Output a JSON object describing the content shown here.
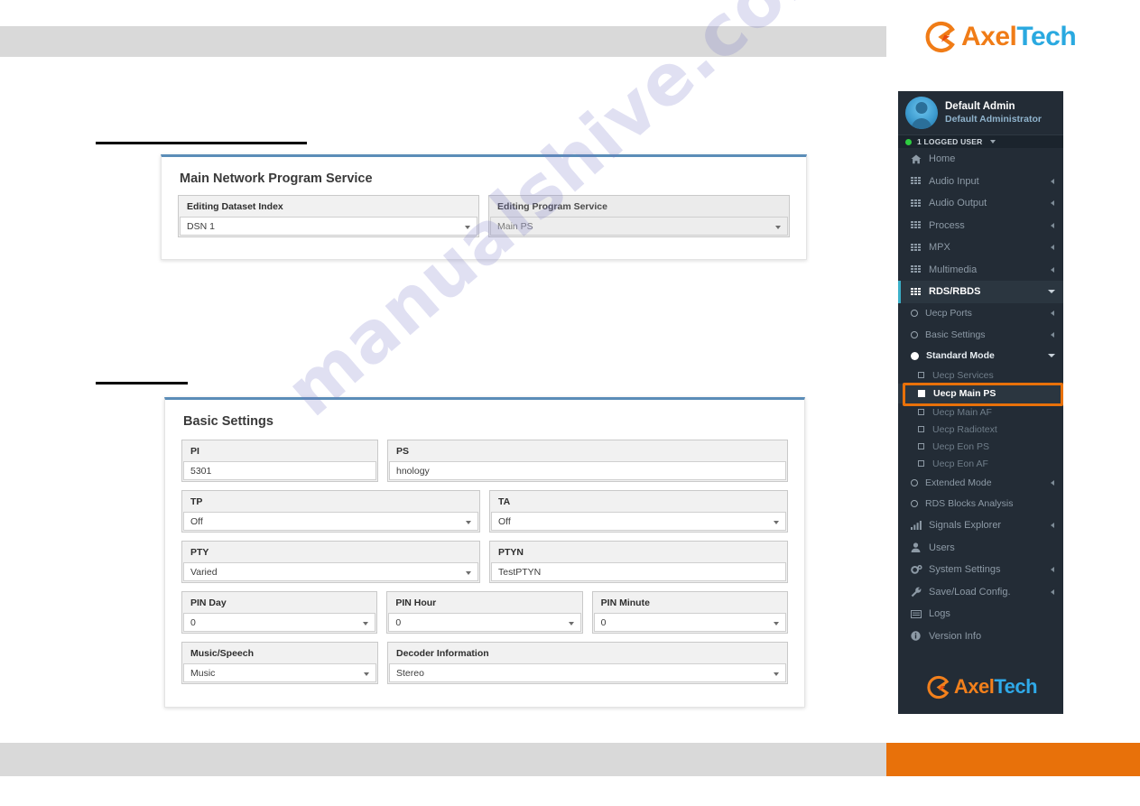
{
  "brand": {
    "name_part1": "Axel",
    "name_part2": "Tech",
    "logo_icon": "axeltech-logo-icon",
    "accent_orange": "#e8710a",
    "accent_blue": "#2aa9e0"
  },
  "watermark": {
    "text": "manualshive.com"
  },
  "sidebar": {
    "user": {
      "name": "Default Admin",
      "role": "Default Administrator",
      "avatar_icon": "user-avatar-icon",
      "status_text": "1 LOGGED USER",
      "status_dot_color": "#2ecc40"
    },
    "menu": [
      {
        "label": "Home",
        "icon": "home-icon",
        "arrow": "none"
      },
      {
        "label": "Audio Input",
        "icon": "grid-icon",
        "arrow": "left"
      },
      {
        "label": "Audio Output",
        "icon": "grid-icon",
        "arrow": "left"
      },
      {
        "label": "Process",
        "icon": "grid-icon",
        "arrow": "left"
      },
      {
        "label": "MPX",
        "icon": "grid-icon",
        "arrow": "left"
      },
      {
        "label": "Multimedia",
        "icon": "grid-icon",
        "arrow": "left"
      },
      {
        "label": "RDS/RBDS",
        "icon": "grid-icon",
        "arrow": "down",
        "active": true
      }
    ],
    "submenu": [
      {
        "label": "Uecp Ports",
        "bullet": "circle-outline",
        "arrow": "left"
      },
      {
        "label": "Basic Settings",
        "bullet": "circle-outline",
        "arrow": "left"
      },
      {
        "label": "Standard Mode",
        "bullet": "circle-filled",
        "arrow": "down",
        "on": true
      }
    ],
    "submenu3": [
      {
        "label": "Uecp Services",
        "bullet": "square-outline"
      },
      {
        "label": "Uecp Main PS",
        "bullet": "square-filled",
        "selected": true
      },
      {
        "label": "Uecp Main AF",
        "bullet": "square-outline"
      },
      {
        "label": "Uecp Radiotext",
        "bullet": "square-outline"
      },
      {
        "label": "Uecp Eon PS",
        "bullet": "square-outline"
      },
      {
        "label": "Uecp Eon AF",
        "bullet": "square-outline"
      }
    ],
    "submenu_tail": [
      {
        "label": "Extended Mode",
        "bullet": "circle-outline",
        "arrow": "left"
      },
      {
        "label": "RDS Blocks Analysis",
        "bullet": "circle-outline",
        "arrow": "none"
      }
    ],
    "menu_bottom": [
      {
        "label": "Signals Explorer",
        "icon": "bar-chart-icon",
        "arrow": "left"
      },
      {
        "label": "Users",
        "icon": "user-icon",
        "arrow": "none"
      },
      {
        "label": "System Settings",
        "icon": "gears-icon",
        "arrow": "left"
      },
      {
        "label": "Save/Load Config.",
        "icon": "wrench-icon",
        "arrow": "left"
      },
      {
        "label": "Logs",
        "icon": "list-icon",
        "arrow": "none"
      },
      {
        "label": "Version Info",
        "icon": "info-icon",
        "arrow": "none"
      }
    ],
    "selection_highlight_color": "#e8710a"
  },
  "panels": [
    {
      "title": "Main Network Program Service",
      "fields": [
        {
          "label": "Editing Dataset Index",
          "value": "DSN 1",
          "control": "select",
          "disabled": false
        },
        {
          "label": "Editing Program Service",
          "value": "Main PS",
          "control": "select",
          "disabled": true
        }
      ]
    },
    {
      "title": "Basic Settings",
      "rows": [
        [
          {
            "label": "PI",
            "value": "5301",
            "control": "text"
          },
          {
            "label": "PS",
            "value": "hnology",
            "control": "text"
          }
        ],
        [
          {
            "label": "TP",
            "value": "Off",
            "control": "select"
          },
          {
            "label": "TA",
            "value": "Off",
            "control": "select"
          }
        ],
        [
          {
            "label": "PTY",
            "value": "Varied",
            "control": "select"
          },
          {
            "label": "PTYN",
            "value": "TestPTYN",
            "control": "text"
          }
        ],
        [
          {
            "label": "PIN Day",
            "value": "0",
            "control": "select"
          },
          {
            "label": "PIN Hour",
            "value": "0",
            "control": "select"
          },
          {
            "label": "PIN Minute",
            "value": "0",
            "control": "select"
          }
        ],
        [
          {
            "label": "Music/Speech",
            "value": "Music",
            "control": "select"
          },
          {
            "label": "Decoder Information",
            "value": "Stereo",
            "control": "select"
          }
        ]
      ]
    }
  ]
}
